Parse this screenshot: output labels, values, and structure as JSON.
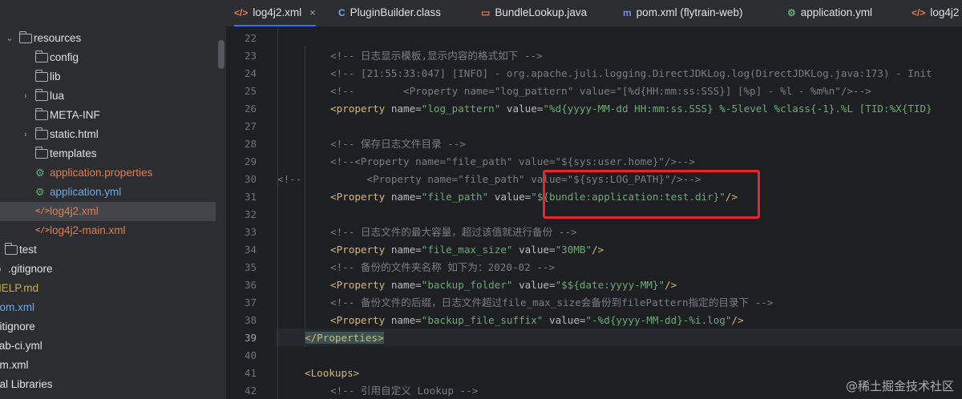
{
  "tabs": [
    {
      "icon": "</>",
      "label": "log4j2.xml",
      "close": "×",
      "active": true
    },
    {
      "icon": "C",
      "label": "PluginBuilder.class"
    },
    {
      "icon": "▭",
      "label": "BundleLookup.java"
    },
    {
      "icon": "m",
      "label": "pom.xml (flytrain-web)"
    },
    {
      "icon": "⚙",
      "label": "application.yml"
    },
    {
      "icon": "</>",
      "label": "log4j2"
    }
  ],
  "tree": [
    {
      "chev": "⌄",
      "icon": "folder",
      "label": "resources",
      "indent": 1
    },
    {
      "icon": "folder",
      "label": "config",
      "indent": 2
    },
    {
      "icon": "folder",
      "label": "lib",
      "indent": 2
    },
    {
      "chev": "›",
      "icon": "folder",
      "label": "lua",
      "indent": 2
    },
    {
      "icon": "folder",
      "label": "META-INF",
      "indent": 2
    },
    {
      "chev": "›",
      "icon": "folder",
      "label": "static.html",
      "indent": 2
    },
    {
      "icon": "folder",
      "label": "templates",
      "indent": 2
    },
    {
      "icon": "yml",
      "label": "application.properties",
      "indent": 2,
      "color": "orange"
    },
    {
      "icon": "yml",
      "label": "application.yml",
      "indent": 2,
      "color": "blue"
    },
    {
      "icon": "xml",
      "label": "log4j2.xml",
      "indent": 2,
      "color": "orange",
      "selected": true
    },
    {
      "icon": "xml",
      "label": "log4j2-main.xml",
      "indent": 2,
      "color": "orange"
    },
    {
      "chev": "›",
      "icon": "folder",
      "label": "test",
      "indent": 0
    },
    {
      "icon": "dot",
      "label": ".gitignore",
      "indent": -1
    },
    {
      "icon": "none",
      "label": "HELP.md",
      "indent": -1,
      "color": "yellow"
    },
    {
      "icon": "none",
      "label": "pom.xml",
      "indent": -1,
      "color": "blue"
    },
    {
      "icon": "none",
      "label": "gitignore",
      "indent": -1
    },
    {
      "icon": "none",
      "label": "tlab-ci.yml",
      "indent": -1
    },
    {
      "icon": "none",
      "label": "om.xml",
      "indent": -1
    },
    {
      "icon": "none",
      "label": "nal Libraries",
      "indent": -1
    }
  ],
  "editor": {
    "current_line": 39,
    "lines": [
      {
        "n": "22",
        "indent": 0,
        "segs": []
      },
      {
        "n": "23",
        "indent": 2,
        "segs": [
          [
            "com",
            "<!-- 日志显示模板,显示内容的格式如下 -->"
          ]
        ]
      },
      {
        "n": "24",
        "indent": 2,
        "segs": [
          [
            "com",
            "<!-- [21:55:33:047] [INFO] - org.apache.juli.logging.DirectJDKLog.log(DirectJDKLog.java:173) - Init"
          ]
        ]
      },
      {
        "n": "25",
        "indent": 2,
        "segs": [
          [
            "com",
            "<!--        <Property name=\"log_pattern\" value=\"[%d{HH:mm:ss:SSS}] [%p] - %l - %m%n\"/>-->"
          ]
        ]
      },
      {
        "n": "26",
        "indent": 2,
        "segs": [
          [
            "tag",
            "<property "
          ],
          [
            "attr",
            "name="
          ],
          [
            "val",
            "\"log_pattern\" "
          ],
          [
            "attr",
            "value="
          ],
          [
            "val",
            "\"%d{yyyy-MM-dd HH:mm:ss.SSS} %-5level %class{-1}.%L [TID:%X{TID}"
          ]
        ]
      },
      {
        "n": "27",
        "indent": 0,
        "segs": []
      },
      {
        "n": "28",
        "indent": 2,
        "segs": [
          [
            "com",
            "<!-- 保存日志文件目录 -->"
          ]
        ]
      },
      {
        "n": "29",
        "indent": 2,
        "segs": [
          [
            "com",
            "<!--<Property name=\"file_path\" value=\"${sys:user.home}\"/>-->"
          ]
        ]
      },
      {
        "n": "30",
        "indent": 0,
        "prefix": "<!--",
        "segs": [
          [
            "com",
            "      <Property name=\"file_path\" value=\"${sys:LOG_PATH}\"/>-->"
          ]
        ]
      },
      {
        "n": "31",
        "indent": 2,
        "segs": [
          [
            "tag",
            "<Property "
          ],
          [
            "attr",
            "name="
          ],
          [
            "val",
            "\"file_path\" "
          ],
          [
            "attr",
            "value="
          ],
          [
            "val",
            "\"${bundle:application:test.dir}\""
          ],
          [
            "tag",
            "/>"
          ]
        ]
      },
      {
        "n": "32",
        "indent": 0,
        "segs": []
      },
      {
        "n": "33",
        "indent": 2,
        "segs": [
          [
            "com",
            "<!-- 日志文件的最大容量，超过该值就进行备份 -->"
          ]
        ]
      },
      {
        "n": "34",
        "indent": 2,
        "segs": [
          [
            "tag",
            "<Property "
          ],
          [
            "attr",
            "name="
          ],
          [
            "val",
            "\"file_max_size\" "
          ],
          [
            "attr",
            "value="
          ],
          [
            "val",
            "\"30MB\""
          ],
          [
            "tag",
            "/>"
          ]
        ]
      },
      {
        "n": "35",
        "indent": 2,
        "segs": [
          [
            "com",
            "<!-- 备份的文件夹名称 如下为：2020-02 -->"
          ]
        ]
      },
      {
        "n": "36",
        "indent": 2,
        "segs": [
          [
            "tag",
            "<Property "
          ],
          [
            "attr",
            "name="
          ],
          [
            "val",
            "\"backup_folder\" "
          ],
          [
            "attr",
            "value="
          ],
          [
            "val",
            "\"$${date:yyyy-MM}\""
          ],
          [
            "tag",
            "/>"
          ]
        ]
      },
      {
        "n": "37",
        "indent": 2,
        "segs": [
          [
            "com",
            "<!-- 备份文件的后缀，日志文件超过file_max_size会备份到filePattern指定的目录下 -->"
          ]
        ]
      },
      {
        "n": "38",
        "indent": 2,
        "segs": [
          [
            "tag",
            "<Property "
          ],
          [
            "attr",
            "name="
          ],
          [
            "val",
            "\"backup_file_suffix\" "
          ],
          [
            "attr",
            "value="
          ],
          [
            "val",
            "\"-%d{yyyy-MM-dd}-%i.log\""
          ],
          [
            "tag",
            "/>"
          ]
        ]
      },
      {
        "n": "39",
        "indent": 1,
        "segs": [
          [
            "taghl",
            "</Properties>"
          ]
        ]
      },
      {
        "n": "40",
        "indent": 0,
        "segs": []
      },
      {
        "n": "41",
        "indent": 1,
        "segs": [
          [
            "tag",
            "<Lookups>"
          ]
        ]
      },
      {
        "n": "42",
        "indent": 2,
        "segs": [
          [
            "com",
            "<!-- 引用自定义 Lookup -->"
          ]
        ]
      }
    ]
  },
  "watermark": "@稀土掘金技术社区",
  "colors": {
    "highlight_box": "#e5262a",
    "accent": "#3574f0"
  }
}
